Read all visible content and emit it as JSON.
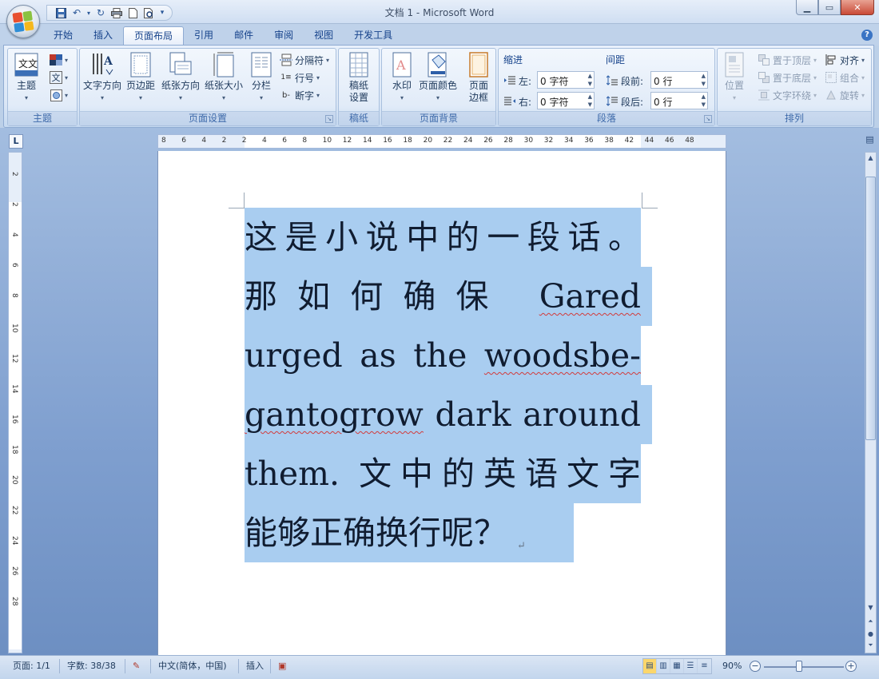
{
  "window": {
    "title": "文档 1 - Microsoft Word"
  },
  "tabs": [
    "开始",
    "插入",
    "页面布局",
    "引用",
    "邮件",
    "审阅",
    "视图",
    "开发工具"
  ],
  "active_tab": "页面布局",
  "ribbon": {
    "theme": {
      "label": "主题",
      "button": "主题"
    },
    "page_setup": {
      "label": "页面设置",
      "text_direction": "文字方向",
      "margins": "页边距",
      "orientation": "纸张方向",
      "size": "纸张大小",
      "columns": "分栏",
      "breaks": "分隔符",
      "line_numbers": "行号",
      "hyphenation": "断字"
    },
    "manuscript": {
      "label": "稿纸",
      "button_line1": "稿纸",
      "button_line2": "设置"
    },
    "page_background": {
      "label": "页面背景",
      "watermark": "水印",
      "page_color": "页面颜色",
      "borders_line1": "页面",
      "borders_line2": "边框"
    },
    "paragraph": {
      "label": "段落",
      "indent_header": "缩进",
      "spacing_header": "间距",
      "indent_left_label": "左:",
      "indent_left_value": "0 字符",
      "indent_right_label": "右:",
      "indent_right_value": "0 字符",
      "spacing_before_label": "段前:",
      "spacing_before_value": "0 行",
      "spacing_after_label": "段后:",
      "spacing_after_value": "0 行"
    },
    "arrange": {
      "label": "排列",
      "position": "位置",
      "bring_front": "置于顶层",
      "send_back": "置于底层",
      "text_wrap": "文字环绕",
      "align": "对齐",
      "group": "组合",
      "rotate": "旋转"
    }
  },
  "ruler": {
    "h_ticks": [
      "8",
      "6",
      "4",
      "2",
      "2",
      "4",
      "6",
      "8",
      "10",
      "12",
      "14",
      "16",
      "18",
      "20",
      "22",
      "24",
      "26",
      "28",
      "30",
      "32",
      "34",
      "36",
      "38",
      "42",
      "44",
      "46",
      "48"
    ],
    "v_ticks": [
      "2",
      "2",
      "4",
      "6",
      "8",
      "10",
      "12",
      "14",
      "16",
      "18",
      "20",
      "22",
      "24",
      "26",
      "28"
    ]
  },
  "document": {
    "lines": [
      "这是小说中的一段话。",
      "那如何确保 ",
      "urged as the ",
      "gantogrow dark around",
      "them. 文中的英语文字",
      "能够正确换行呢？"
    ],
    "line2_word": "Gared",
    "line3_word": "woodsbe-",
    "line4_word": "gantogrow",
    "line4_rest": " dark around",
    "para_mark": "↵"
  },
  "status": {
    "page": "页面: 1/1",
    "words": "字数: 38/38",
    "language": "中文(简体，中国)",
    "mode": "插入",
    "zoom": "90%",
    "zoom_level": 0.9
  }
}
